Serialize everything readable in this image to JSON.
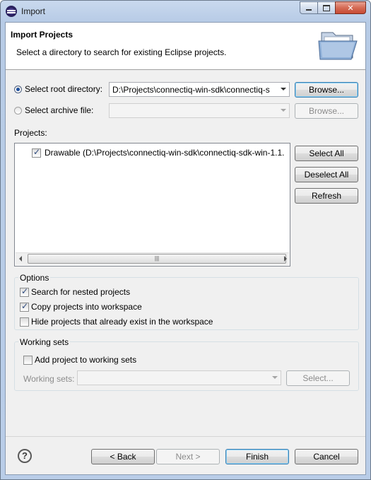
{
  "window": {
    "title": "Import"
  },
  "banner": {
    "title": "Import Projects",
    "description": "Select a directory to search for existing Eclipse projects."
  },
  "root_dir": {
    "label": "Select root directory:",
    "value": "D:\\Projects\\connectiq-win-sdk\\connectiq-s",
    "browse": "Browse..."
  },
  "archive": {
    "label": "Select archive file:",
    "value": "",
    "browse": "Browse..."
  },
  "projects": {
    "label": "Projects:",
    "items": [
      {
        "label": "Drawable (D:\\Projects\\connectiq-win-sdk\\connectiq-sdk-win-1.1.",
        "checked": true
      }
    ],
    "select_all": "Select All",
    "deselect_all": "Deselect All",
    "refresh": "Refresh"
  },
  "options": {
    "title": "Options",
    "nested": "Search for nested projects",
    "copy": "Copy projects into workspace",
    "hide": "Hide projects that already exist in the workspace"
  },
  "working_sets": {
    "title": "Working sets",
    "add": "Add project to working sets",
    "label": "Working sets:",
    "value": "",
    "select": "Select..."
  },
  "footer": {
    "back": "< Back",
    "next": "Next >",
    "finish": "Finish",
    "cancel": "Cancel"
  }
}
